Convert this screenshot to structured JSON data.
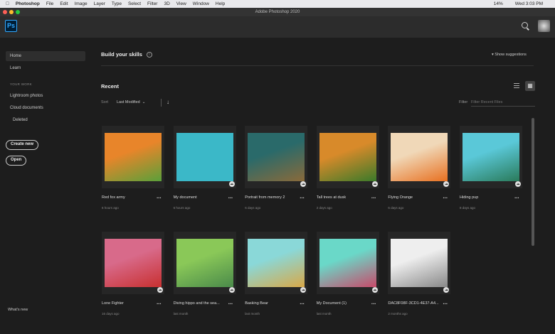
{
  "menubar": {
    "apple": "",
    "items": [
      "Photoshop",
      "File",
      "Edit",
      "Image",
      "Layer",
      "Type",
      "Select",
      "Filter",
      "3D",
      "View",
      "Window",
      "Help"
    ],
    "battery": "14%",
    "clock": "Wed 3:03 PM"
  },
  "window": {
    "title": "Adobe Photoshop 2020"
  },
  "header": {
    "logo": "Ps"
  },
  "sidebar": {
    "home": "Home",
    "learn": "Learn",
    "section": "YOUR WORK",
    "lightroom": "Lightroom photos",
    "cloud": "Cloud documents",
    "deleted": "Deleted",
    "create": "Create new",
    "open": "Open",
    "whats_new": "What's new"
  },
  "main": {
    "skills": "Build your skills",
    "info": "i",
    "suggestions": "Show suggestions",
    "recent": "Recent",
    "sort_label": "Sort",
    "sort_value": "Last Modified",
    "filter_label": "Filter",
    "filter_placeholder": "Filter Recent Files"
  },
  "files": [
    {
      "name": "Red fox army",
      "date": "6 hours ago",
      "colors": [
        "#e8852a",
        "#5aa03a"
      ]
    },
    {
      "name": "My document",
      "date": "6 hours ago",
      "colors": [
        "#3bb8c8",
        "#3bb8c8"
      ]
    },
    {
      "name": "Portrait from memory 2",
      "date": "6 days ago",
      "colors": [
        "#2a6a6a",
        "#8a6a3a"
      ]
    },
    {
      "name": "Tall trees at dusk",
      "date": "2 days ago",
      "colors": [
        "#d88a2a",
        "#3a7a2a"
      ]
    },
    {
      "name": "Flying Orange",
      "date": "6 days ago",
      "colors": [
        "#f0d8b8",
        "#e87020"
      ]
    },
    {
      "name": "Hiding pup",
      "date": "8 days ago",
      "colors": [
        "#5ac8d8",
        "#2a7a5a"
      ]
    },
    {
      "name": "Lone Fighter",
      "date": "16 days ago",
      "colors": [
        "#d86a8a",
        "#c83030"
      ]
    },
    {
      "name": "Diving hippo and the sea...",
      "date": "last month",
      "colors": [
        "#8ac858",
        "#4a8a4a"
      ]
    },
    {
      "name": "Basking Bear",
      "date": "last month",
      "colors": [
        "#8ad8d8",
        "#d8a848"
      ]
    },
    {
      "name": "My Document (1)",
      "date": "last month",
      "colors": [
        "#6ad8c8",
        "#c84a6a"
      ]
    },
    {
      "name": "DAC8F08F-3CD1-4E37-A4...",
      "date": "2 months ago",
      "colors": [
        "#eeeeee",
        "#888888"
      ]
    }
  ]
}
